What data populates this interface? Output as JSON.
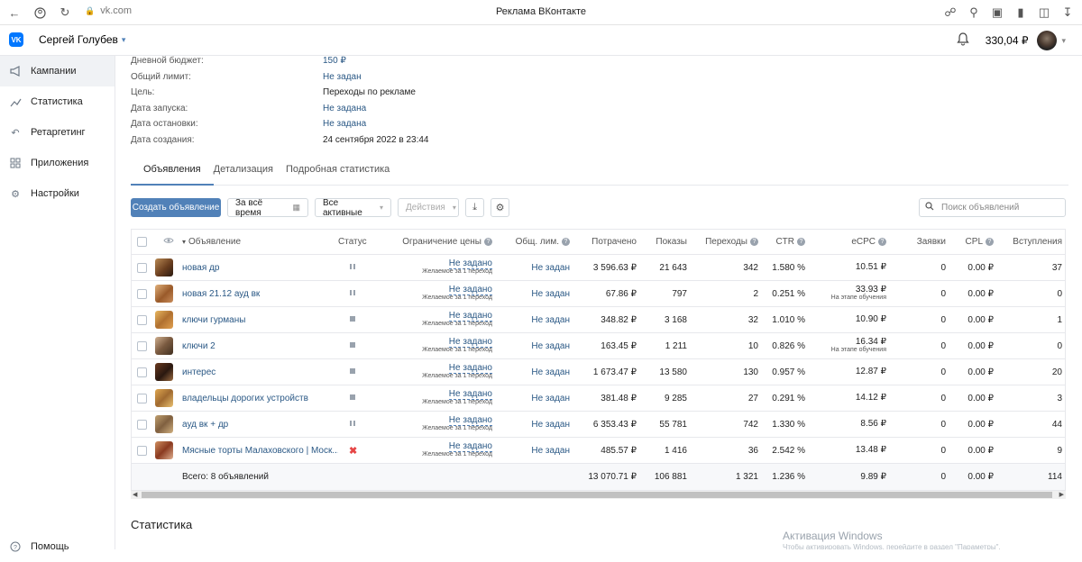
{
  "browser": {
    "url": "vk.com",
    "title": "Реклама ВКонтакте"
  },
  "header": {
    "logo": "VK",
    "user": "Сергей Голубев",
    "balance": "330,04 ₽"
  },
  "sidebar": {
    "items": [
      {
        "label": "Кампании",
        "icon": "megaphone-icon",
        "active": true
      },
      {
        "label": "Статистика",
        "icon": "chart-icon",
        "active": false
      },
      {
        "label": "Ретаргетинг",
        "icon": "retarget-icon",
        "active": false
      },
      {
        "label": "Приложения",
        "icon": "apps-icon",
        "active": false
      },
      {
        "label": "Настройки",
        "icon": "gear-icon",
        "active": false
      }
    ],
    "help": "Помощь"
  },
  "info": [
    {
      "label": "Дневной бюджет:",
      "value": "150 ₽",
      "link": true
    },
    {
      "label": "Общий лимит:",
      "value": "Не задан",
      "link": true
    },
    {
      "label": "Цель:",
      "value": "Переходы по рекламе",
      "link": false
    },
    {
      "label": "Дата запуска:",
      "value": "Не задана",
      "link": true
    },
    {
      "label": "Дата остановки:",
      "value": "Не задана",
      "link": true
    },
    {
      "label": "Дата создания:",
      "value": "24 сентября 2022 в 23:44",
      "link": false
    }
  ],
  "tabs": [
    "Объявления",
    "Детализация",
    "Подробная статистика"
  ],
  "toolbar": {
    "create": "Создать объявление",
    "period": "За всё время",
    "filter": "Все активные",
    "actions": "Действия",
    "search_placeholder": "Поиск объявлений"
  },
  "columns": {
    "ad": "Объявление",
    "status": "Статус",
    "price_limit": "Ограничение цены",
    "total_limit": "Общ. лим.",
    "spent": "Потрачено",
    "impressions": "Показы",
    "clicks": "Переходы",
    "ctr": "CTR",
    "ecpc": "eCPC",
    "leads": "Заявки",
    "cpl": "CPL",
    "joins": "Вступления"
  },
  "limit_text": {
    "value": "Не задано",
    "sub": "Желаемое за 1 переход",
    "total": "Не задан"
  },
  "ecpc_learning": "На этапе обучения",
  "rows": [
    {
      "name": "новая др",
      "status": "pause",
      "spent": "3 596.63 ₽",
      "impressions": "21 643",
      "clicks": "342",
      "ctr": "1.580 %",
      "ecpc": "10.51 ₽",
      "learning": false,
      "leads": "0",
      "cpl": "0.00 ₽",
      "joins": "37"
    },
    {
      "name": "новая 21.12 ауд вк",
      "status": "pause",
      "spent": "67.86 ₽",
      "impressions": "797",
      "clicks": "2",
      "ctr": "0.251 %",
      "ecpc": "33.93 ₽",
      "learning": true,
      "leads": "0",
      "cpl": "0.00 ₽",
      "joins": "0"
    },
    {
      "name": "ключи гурманы",
      "status": "stop",
      "spent": "348.82 ₽",
      "impressions": "3 168",
      "clicks": "32",
      "ctr": "1.010 %",
      "ecpc": "10.90 ₽",
      "learning": false,
      "leads": "0",
      "cpl": "0.00 ₽",
      "joins": "1"
    },
    {
      "name": "ключи 2",
      "status": "stop",
      "spent": "163.45 ₽",
      "impressions": "1 211",
      "clicks": "10",
      "ctr": "0.826 %",
      "ecpc": "16.34 ₽",
      "learning": true,
      "leads": "0",
      "cpl": "0.00 ₽",
      "joins": "0"
    },
    {
      "name": "интерес",
      "status": "stop",
      "spent": "1 673.47 ₽",
      "impressions": "13 580",
      "clicks": "130",
      "ctr": "0.957 %",
      "ecpc": "12.87 ₽",
      "learning": false,
      "leads": "0",
      "cpl": "0.00 ₽",
      "joins": "20"
    },
    {
      "name": "владельцы дорогих устройств",
      "status": "stop",
      "spent": "381.48 ₽",
      "impressions": "9 285",
      "clicks": "27",
      "ctr": "0.291 %",
      "ecpc": "14.12 ₽",
      "learning": false,
      "leads": "0",
      "cpl": "0.00 ₽",
      "joins": "3"
    },
    {
      "name": "ауд вк + др",
      "status": "pause",
      "spent": "6 353.43 ₽",
      "impressions": "55 781",
      "clicks": "742",
      "ctr": "1.330 %",
      "ecpc": "8.56 ₽",
      "learning": false,
      "leads": "0",
      "cpl": "0.00 ₽",
      "joins": "44"
    },
    {
      "name": "Мясные торты Малаховского | Моск...",
      "status": "rejected",
      "spent": "485.57 ₽",
      "impressions": "1 416",
      "clicks": "36",
      "ctr": "2.542 %",
      "ecpc": "13.48 ₽",
      "learning": false,
      "leads": "0",
      "cpl": "0.00 ₽",
      "joins": "9"
    }
  ],
  "total": {
    "label": "Всего: 8 объявлений",
    "spent": "13 070.71 ₽",
    "impressions": "106 881",
    "clicks": "1 321",
    "ctr": "1.236 %",
    "ecpc": "9.89 ₽",
    "leads": "0",
    "cpl": "0.00 ₽",
    "joins": "114"
  },
  "stat_title": "Статистика",
  "watermark": "Активация Windows",
  "watermark_sub": "Чтобы активировать Windows, перейдите в раздел \"Параметры\"."
}
